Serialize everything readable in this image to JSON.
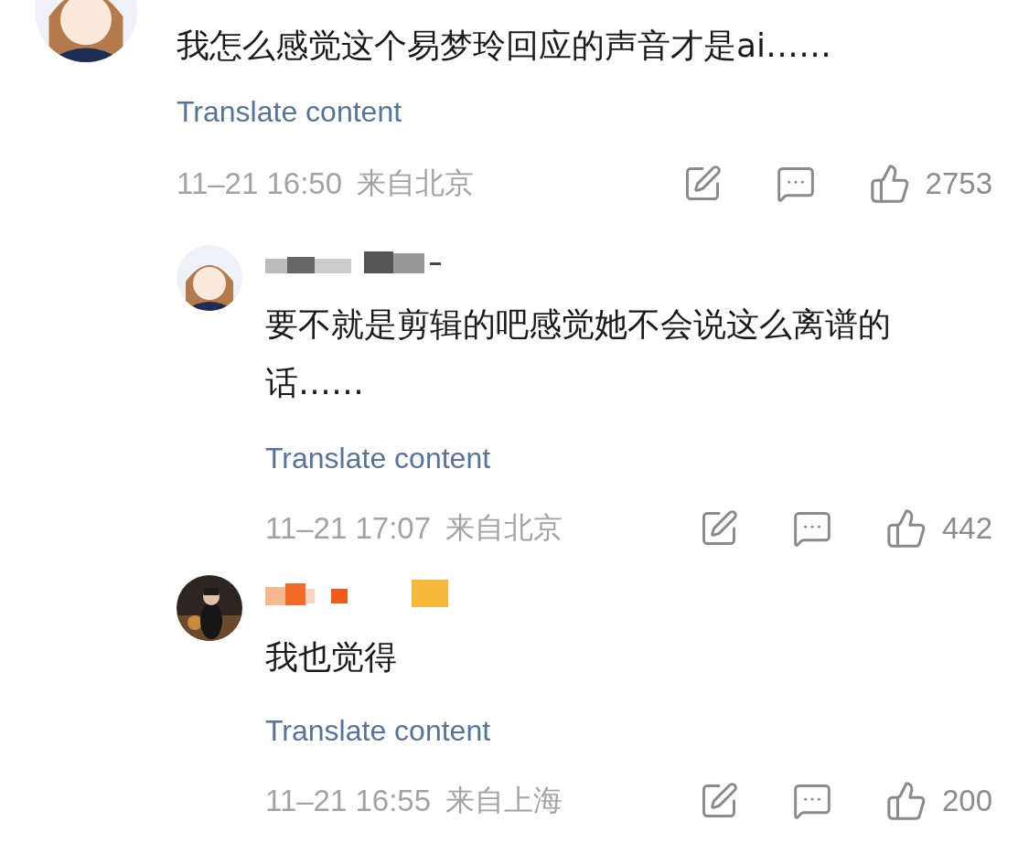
{
  "comment": {
    "kind": "cartoon",
    "text": "我怎么感觉这个易梦玲回应的声音才是ai……",
    "translate": "Translate content",
    "time": "11–21 16:50",
    "location": "来自北京",
    "like_count": "2753",
    "replies": [
      {
        "kind": "cartoon",
        "text": "要不就是剪辑的吧感觉她不会说这么离谱的话……",
        "translate": "Translate content",
        "time": "11–21 17:07",
        "location": "来自北京",
        "like_count": "442"
      },
      {
        "text": "我也觉得",
        "translate": "Translate content",
        "time": "11–21 16:55",
        "location": "来自上海",
        "like_count": "200"
      }
    ]
  }
}
